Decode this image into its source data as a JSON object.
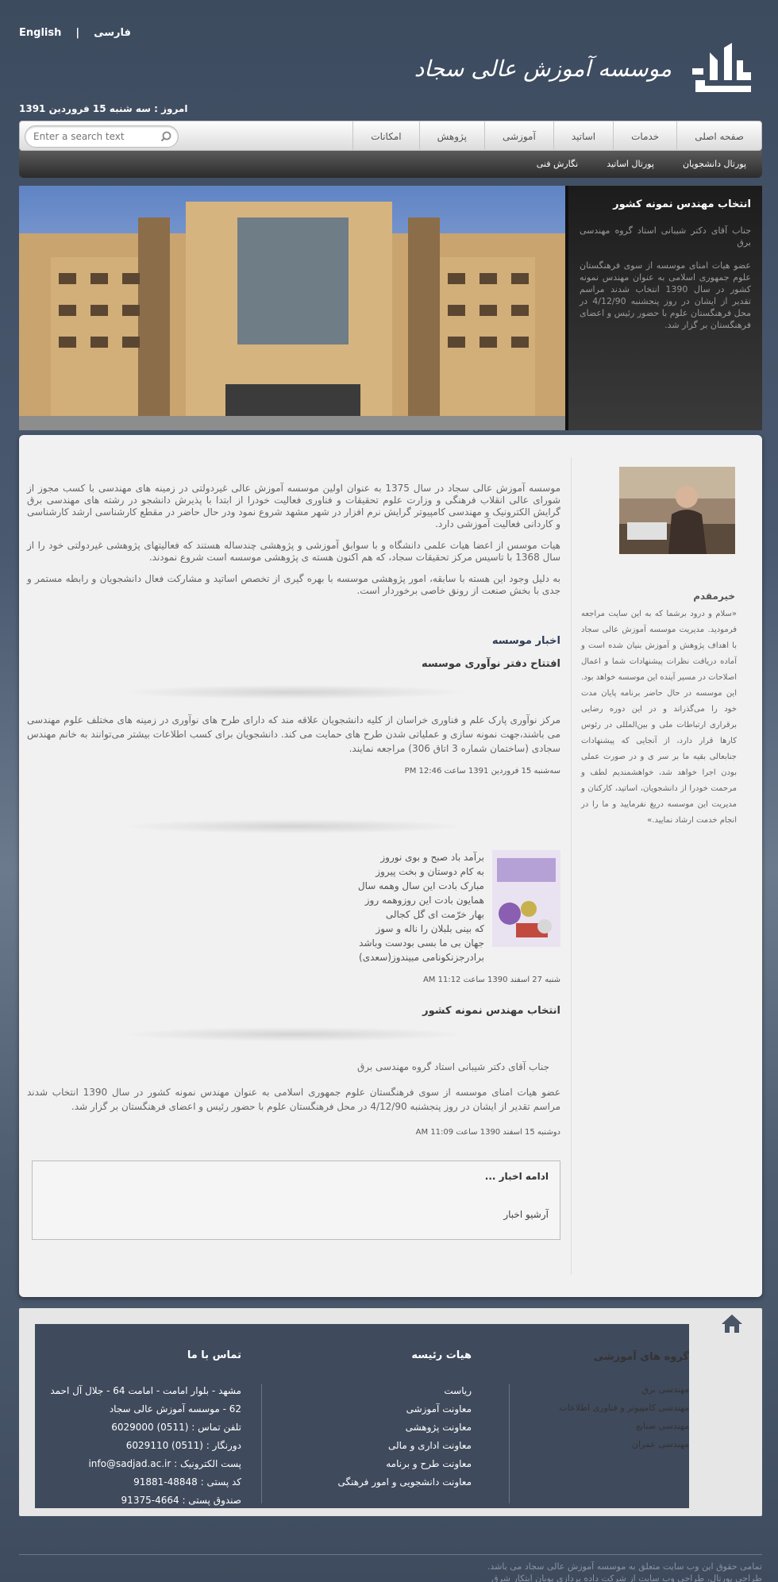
{
  "header": {
    "lang_en": "English",
    "lang_sep": "|",
    "lang_fa": "فارسی",
    "logo_text": "موسسه آموزش عالی سجاد",
    "date": "امروز : سه شنبه 15 فروردین 1391"
  },
  "nav": {
    "items": [
      "صفحه اصلی",
      "خدمات",
      "اساتید",
      "آموزشی",
      "پژوهش",
      "امکانات"
    ],
    "search_placeholder": "Enter a search text"
  },
  "subnav": {
    "items": [
      "پورتال دانشجویان",
      "پورتال اساتید",
      "نگارش فنی"
    ]
  },
  "banner": {
    "side_title": "انتخاب مهندس نمونه کشور",
    "side_p1": "جناب آقای دکتر شیبانی استاد گروه مهندسی برق",
    "side_p2": "عضو هیات امنای موسسه از سوی فرهنگستان علوم جمهوری اسلامی به عنوان مهندس نمونه کشور در سال 1390 انتخاب شدند مراسم تقدیر از ایشان در روز پنجشنبه 4/12/90 در محل فرهنگستان علوم با حضور رئیس و اعضای فرهنگستان بر گزار شد."
  },
  "sidebar": {
    "welcome_title": "خیرمقدم",
    "welcome_text": "«سلام و درود برشما که به این سایت مراجعه فرمودید. مدیریت موسسه آموزش عالی سجاد با اهداف پژوهش و آموزش بنیان شده است و آماده دریافت نظرات پیشنهادات شما و اعمال اصلاحات در مسیر آینده این موسسه خواهد بود. این موسسه در حال حاضر برنامه پایان مدت خود را می‌گذراند و در این دوره رضایی برقراری ارتباطات ملی و بین‌المللی در رئوس کارها قرار دارد، از آنجایی که پیشنهادات جنابعالی بقیه ما بر سر ی و در صورت عملی بودن اجرا خواهد شد، خواهشمندیم لطف و مرحمت خودرا از دانشجویان، اساتید، کارکنان و مدیریت این موسسه دریغ نفرمایید و ما را در انجام خدمت ارشاد نمایید.»"
  },
  "intro": {
    "p1": "موسسه آموزش عالی سجاد در سال 1375 به عنوان اولین موسسه آموزش عالی غیردولتی در زمینه های مهندسی با کسب مجوز از شورای عالی انقلاب فرهنگی و وزارت علوم تحقیقات و فناوری فعالیت خودرا از ابتدا با پذیرش دانشجو در رشته های مهندسی برق گرایش الکترونیک و مهندسی کامپیوتر گرایش نرم افزار در شهر مشهد شروع نمود ودر حال حاضر در مقطع کارشناسی ارشد کارشناسی و کاردانی فعالیت آموزشی دارد.",
    "p2": "هیات موسس از اعضا هیات علمی دانشگاه و با سوابق آموزشی و پژوهشی چندساله هستند که فعالیتهای پژوهشی غیردولتی خود را از سال 1368 با تاسیس مرکز تحقیقات سجاد، که هم اکنون هسته ی پژوهشی موسسه است شروع نمودند.",
    "p3": "به دلیل وجود این هسته با سابقه، امور پژوهشی موسسه با بهره گیری از تخصص اساتید و مشارکت فعال دانشجویان و رابطه مستمر و جدی با بخش صنعت از رونق خاصی برخوردار است."
  },
  "news": {
    "heading": "اخبار موسسه",
    "item1_title": "افتتاح دفتر نوآوری موسسه",
    "item1_body": "مرکز نوآوری پارک علم و فناوری خراسان از کلیه دانشجویان علاقه مند که دارای طرح های نوآوری در زمینه های مختلف علوم مهندسی می باشند،جهت نمونه سازی و عملیاتی شدن طرح های حمایت می کند. دانشجویان برای کسب اطلاعات بیشتر می‌توانند به خانم مهندس سجادی (ساختمان شماره 3 اتاق 306) مراجعه نمایند.",
    "item1_date": "سه‌شنبه 15 فروردین 1391 ساعت 12:46 PM",
    "poem": [
      "برآمد باد صبح و بوی نوروز",
      "به کام دوستان و بخت پیروز",
      "مبارک بادت این سال وهمه سال",
      "همایون بادت این روزوهمه روز",
      "بهار خرّمت ای گل کجالی",
      "که بینی بلبلان را ناله و سوز",
      "جهان بی ما بسی بودست وباشد",
      "برادرجزنکونامی مبیندوز(سعدی)"
    ],
    "item2_date": "شنبه 27 اسفند 1390 ساعت 11:12 AM",
    "item3_title": "انتخاب مهندس نمونه کشور",
    "item3_p1": "جناب آقای دکتر شیبانی استاد گروه مهندسی برق",
    "item3_p2": "عضو هیات امنای موسسه از سوی فرهنگستان علوم جمهوری اسلامی به عنوان مهندس نمونه کشور در سال 1390 انتخاب شدند مراسم تقدیر از ایشان در روز پنجشنبه 4/12/90 در محل فرهنگستان علوم با حضور رئیس و اعضای فرهنگستان بر گزار شد.",
    "item3_date": "دوشنبه 15 اسفند 1390 ساعت 11:09 AM",
    "more_title": "ادامه اخبار ...",
    "archive": "آرشیو اخبار"
  },
  "footer": {
    "groups_title": "گروه های آموزشی",
    "groups": [
      "مهندسی برق",
      "مهندسی کامپیوتر و فناوری اطلاعات",
      "مهندسی صنایع",
      "مهندسی عمران"
    ],
    "board_title": "هیات رئیسه",
    "board": [
      "ریاست",
      "معاونت آموزشی",
      "معاونت پژوهشی",
      "معاونت اداری و مالی",
      "معاونت طرح و برنامه",
      "معاونت دانشجویی و امور فرهنگی"
    ],
    "contact_title": "تماس با ما",
    "contact": [
      "مشهد - بلوار امامت - امامت 64 - جلال آل احمد",
      "62 - موسسه آموزش عالی سجاد",
      "تلفن تماس : (0511) 6029000",
      "دورنگار : (0511) 6029110",
      "پست الکترونیک : info@sadjad.ac.ir",
      "کد پستی : 48848-91881",
      "صندوق پستی : 4664-91375"
    ],
    "copyright1": "تمامی حقوق این وب سایت متعلق به موسسه آموزش عالی سجاد می باشد.",
    "copyright2": "طراحی پورتال، طراحی وب سایت از شرکت داده پردازی پویان ابتکار شرق"
  }
}
